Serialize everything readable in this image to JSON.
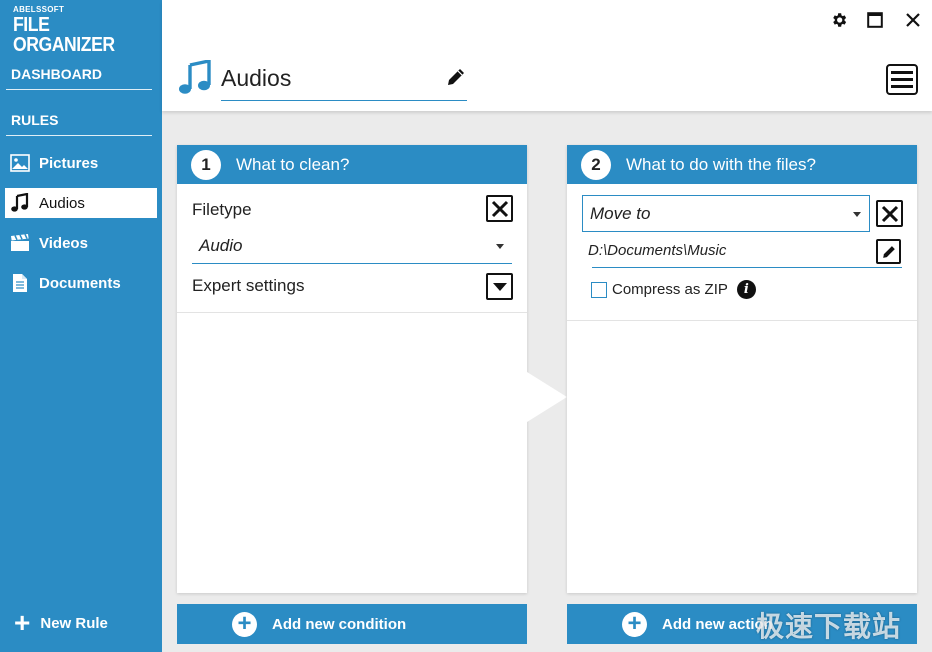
{
  "app": {
    "brand": "ABELSSOFT",
    "product": "FILE ORGANIZER"
  },
  "sidebar": {
    "dashboard_label": "DASHBOARD",
    "rules_label": "RULES",
    "items": [
      {
        "label": "Pictures",
        "icon": "picture-icon"
      },
      {
        "label": "Audios",
        "icon": "music-note-icon",
        "active": true
      },
      {
        "label": "Videos",
        "icon": "clapperboard-icon"
      },
      {
        "label": "Documents",
        "icon": "document-icon"
      }
    ],
    "new_rule_label": "New Rule"
  },
  "header": {
    "rule_title": "Audios"
  },
  "condition_panel": {
    "step": "1",
    "title": "What to clean?",
    "filetype_label": "Filetype",
    "filetype_value": "Audio",
    "expert_label": "Expert settings",
    "add_label": "Add new condition"
  },
  "action_panel": {
    "step": "2",
    "title": "What to do with the files?",
    "action_value": "Move to",
    "path_value": "D:\\Documents\\Music",
    "compress_label": "Compress as ZIP",
    "compress_checked": false,
    "add_label": "Add new action"
  },
  "watermark": "极速下载站",
  "colors": {
    "accent": "#2b8cc4",
    "background": "#ebebeb"
  }
}
